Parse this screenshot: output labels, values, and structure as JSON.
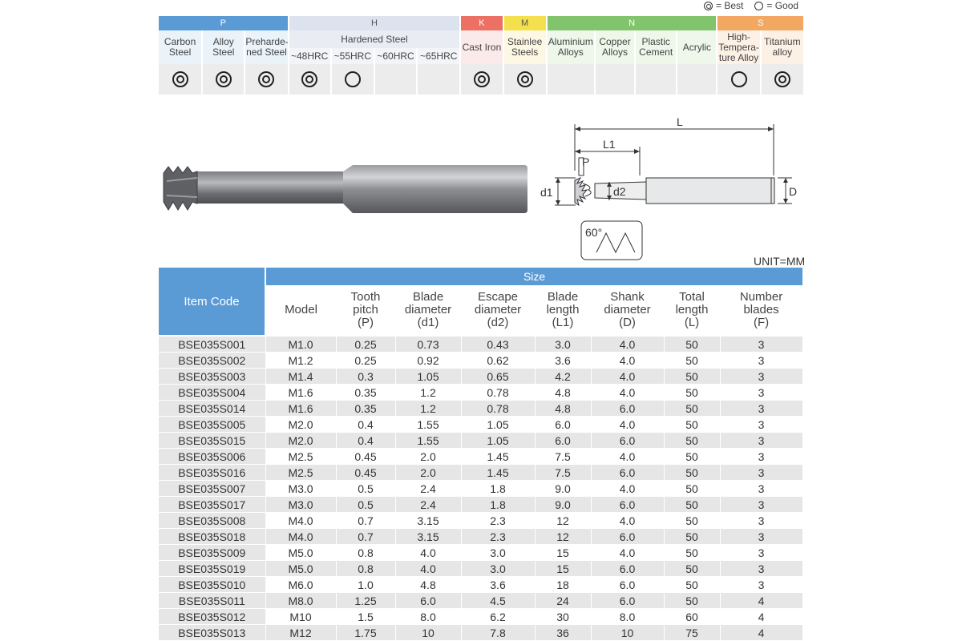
{
  "legend": {
    "best": "= Best",
    "good": "= Good"
  },
  "materials": {
    "groups": [
      {
        "label": "P",
        "color": "#5b9bd5"
      },
      {
        "label": "H",
        "color": "#dde3ee"
      },
      {
        "label": "K",
        "color": "#ec7063"
      },
      {
        "label": "M",
        "color": "#f4e04d"
      },
      {
        "label": "N",
        "color": "#82c46b"
      },
      {
        "label": "S",
        "color": "#f2a862"
      }
    ],
    "hardened_label": "Hardened Steel",
    "columns": [
      {
        "label": "Carbon Steel",
        "rating": "best"
      },
      {
        "label": "Alloy Steel",
        "rating": "best"
      },
      {
        "label": "Preharde-ned Steel",
        "rating": "best"
      },
      {
        "label": "~48HRC",
        "rating": "best"
      },
      {
        "label": "~55HRC",
        "rating": "good"
      },
      {
        "label": "~60HRC",
        "rating": ""
      },
      {
        "label": "~65HRC",
        "rating": ""
      },
      {
        "label": "Cast Iron",
        "rating": "best"
      },
      {
        "label": "Stainlee Steels",
        "rating": "best"
      },
      {
        "label": "Aluminium Alloys",
        "rating": ""
      },
      {
        "label": "Copper Alloys",
        "rating": ""
      },
      {
        "label": "Plastic Cement",
        "rating": ""
      },
      {
        "label": "Acrylic",
        "rating": ""
      },
      {
        "label": "High-Tempera-ture Alloy",
        "rating": "good"
      },
      {
        "label": "Titanium alloy",
        "rating": "best"
      }
    ]
  },
  "drawing": {
    "L": "L",
    "L1": "L1",
    "P": "P",
    "d1": "d1",
    "d2": "d2",
    "D": "D",
    "angle": "60°"
  },
  "unit": "UNIT=MM",
  "table": {
    "item_code_header": "Item Code",
    "size_header": "Size",
    "columns": [
      "Model",
      "Tooth pitch (P)",
      "Blade diameter (d1)",
      "Escape diameter (d2)",
      "Blade length (L1)",
      "Shank diameter (D)",
      "Total length (L)",
      "Number blades (F)"
    ],
    "rows": [
      [
        "BSE035S001",
        "M1.0",
        "0.25",
        "0.73",
        "0.43",
        "3.0",
        "4.0",
        "50",
        "3"
      ],
      [
        "BSE035S002",
        "M1.2",
        "0.25",
        "0.92",
        "0.62",
        "3.6",
        "4.0",
        "50",
        "3"
      ],
      [
        "BSE035S003",
        "M1.4",
        "0.3",
        "1.05",
        "0.65",
        "4.2",
        "4.0",
        "50",
        "3"
      ],
      [
        "BSE035S004",
        "M1.6",
        "0.35",
        "1.2",
        "0.78",
        "4.8",
        "4.0",
        "50",
        "3"
      ],
      [
        "BSE035S014",
        "M1.6",
        "0.35",
        "1.2",
        "0.78",
        "4.8",
        "6.0",
        "50",
        "3"
      ],
      [
        "BSE035S005",
        "M2.0",
        "0.4",
        "1.55",
        "1.05",
        "6.0",
        "4.0",
        "50",
        "3"
      ],
      [
        "BSE035S015",
        "M2.0",
        "0.4",
        "1.55",
        "1.05",
        "6.0",
        "6.0",
        "50",
        "3"
      ],
      [
        "BSE035S006",
        "M2.5",
        "0.45",
        "2.0",
        "1.45",
        "7.5",
        "4.0",
        "50",
        "3"
      ],
      [
        "BSE035S016",
        "M2.5",
        "0.45",
        "2.0",
        "1.45",
        "7.5",
        "6.0",
        "50",
        "3"
      ],
      [
        "BSE035S007",
        "M3.0",
        "0.5",
        "2.4",
        "1.8",
        "9.0",
        "4.0",
        "50",
        "3"
      ],
      [
        "BSE035S017",
        "M3.0",
        "0.5",
        "2.4",
        "1.8",
        "9.0",
        "6.0",
        "50",
        "3"
      ],
      [
        "BSE035S008",
        "M4.0",
        "0.7",
        "3.15",
        "2.3",
        "12",
        "4.0",
        "50",
        "3"
      ],
      [
        "BSE035S018",
        "M4.0",
        "0.7",
        "3.15",
        "2.3",
        "12",
        "6.0",
        "50",
        "3"
      ],
      [
        "BSE035S009",
        "M5.0",
        "0.8",
        "4.0",
        "3.0",
        "15",
        "4.0",
        "50",
        "3"
      ],
      [
        "BSE035S019",
        "M5.0",
        "0.8",
        "4.0",
        "3.0",
        "15",
        "6.0",
        "50",
        "3"
      ],
      [
        "BSE035S010",
        "M6.0",
        "1.0",
        "4.8",
        "3.6",
        "18",
        "6.0",
        "50",
        "3"
      ],
      [
        "BSE035S011",
        "M8.0",
        "1.25",
        "6.0",
        "4.5",
        "24",
        "6.0",
        "50",
        "4"
      ],
      [
        "BSE035S012",
        "M10",
        "1.5",
        "8.0",
        "6.2",
        "30",
        "8.0",
        "60",
        "4"
      ],
      [
        "BSE035S013",
        "M12",
        "1.75",
        "10",
        "7.8",
        "36",
        "10",
        "75",
        "4"
      ]
    ]
  }
}
